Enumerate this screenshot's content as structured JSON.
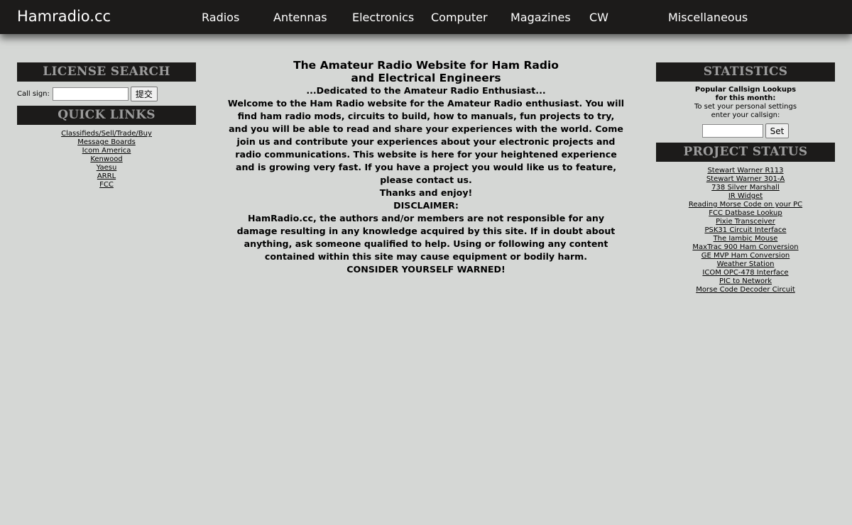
{
  "header": {
    "site_title": "Hamradio.cc",
    "nav": [
      "Radios",
      "Antennas",
      "Electronics",
      "Computer",
      "Magazines",
      "CW",
      "Miscellaneous"
    ]
  },
  "license_search": {
    "heading": "LICENSE SEARCH",
    "callsign_label": "Call sign:",
    "callsign_value": "",
    "submit_label": "提交"
  },
  "quick_links": {
    "heading": "QUICK LINKS",
    "items": [
      "Classifieds/Sell/Trade/Buy",
      "Message Boards",
      "Icom America",
      "Kenwood",
      "Yaesu",
      "ARRL",
      "FCC"
    ]
  },
  "main": {
    "title_line1": "The Amateur Radio Website for Ham Radio",
    "title_line2": "and Electrical Engineers",
    "tagline": "...Dedicated to the Amateur Radio Enthusiast...",
    "welcome": "Welcome to the Ham Radio website for the Amateur Radio enthusiast. You will find ham radio mods, circuits to build, how to manuals, fun projects to try, and you will be able to read and share your experiences with the world. Come join us and contribute your experiences about your electronic projects and radio communications. This website is here for your heightened experience and is growing very fast. If you have a project you would like us to feature, please contact us.",
    "thanks": "Thanks and enjoy!",
    "disclaimer_heading": "DISCLAIMER:",
    "disclaimer_text": "HamRadio.cc, the authors and/or members are not responsible for any damage resulting in any knowledge acquired by this site. If in doubt about anything, ask someone qualified to help. Using or following any content contained within this site may cause equipment or bodily harm.",
    "warning": "CONSIDER YOURSELF WARNED!"
  },
  "statistics": {
    "heading": "STATISTICS",
    "popular_line1": "Popular Callsign Lookups",
    "popular_line2": "for this month:",
    "settings_line1": "To set your personal settings",
    "settings_line2": "enter your callsign:",
    "callsign_value": "",
    "set_label": "Set"
  },
  "project_status": {
    "heading": "PROJECT STATUS",
    "items": [
      "Stewart Warner R113",
      "Stewart Warner 301-A",
      "738 Silver Marshall",
      "IR Widget",
      "Reading Morse Code on your PC",
      "FCC Datbase Lookup",
      "Pixie Transceiver",
      "PSK31 Circuit Interface",
      "The Iambic Mouse",
      "MaxTrac 900 Ham Conversion",
      "GE MVP Ham Conversion",
      "Weather Station",
      "ICOM OPC-478 Interface",
      "PIC to Network",
      "Morse Code Decoder Circuit"
    ]
  },
  "colors": {
    "page_bg": "#d5d7d5",
    "bar_bg": "#1c1b1a",
    "box_heading_text": "#9c9c9c"
  }
}
